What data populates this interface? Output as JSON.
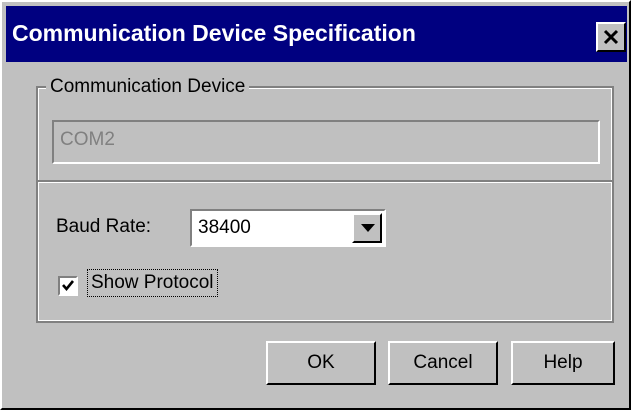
{
  "window": {
    "title": "Communication Device Specification",
    "close_icon": "close-icon"
  },
  "group": {
    "legend": "Communication Device",
    "device_value": "COM2"
  },
  "baud": {
    "label": "Baud Rate:",
    "value": "38400",
    "dropdown_icon": "dropdown-arrow-icon"
  },
  "protocol": {
    "label": "Show Protocol",
    "checked": true,
    "check_icon": "checkmark-icon"
  },
  "buttons": {
    "ok": "OK",
    "cancel": "Cancel",
    "help": "Help"
  },
  "colors": {
    "titlebar": "#000080",
    "face": "#c0c0c0",
    "disabled_text": "#808080"
  }
}
